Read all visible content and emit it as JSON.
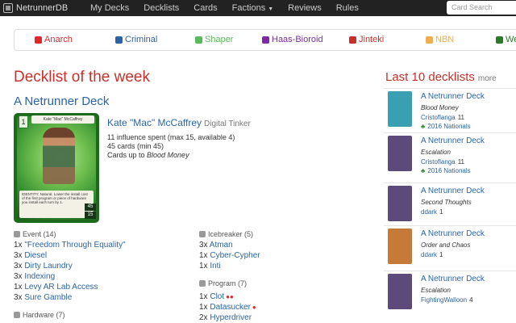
{
  "nav": {
    "brand": "NetrunnerDB",
    "items": [
      {
        "label": "My Decks"
      },
      {
        "label": "Decklists"
      },
      {
        "label": "Cards"
      },
      {
        "label": "Factions"
      },
      {
        "label": "Reviews"
      },
      {
        "label": "Rules"
      }
    ],
    "search_placeholder": "Card Search"
  },
  "factions": [
    {
      "label": "Anarch",
      "color": "#e3262a",
      "icon": "anarch-icon"
    },
    {
      "label": "Criminal",
      "color": "#2a64a6",
      "icon": "criminal-icon"
    },
    {
      "label": "Shaper",
      "color": "#5cb85c",
      "icon": "shaper-icon"
    },
    {
      "label": "Haas-Bioroid",
      "color": "#7e2aa6",
      "icon": "haas-bioroid-icon"
    },
    {
      "label": "Jinteki",
      "color": "#c9302c",
      "icon": "jinteki-icon"
    },
    {
      "label": "NBN",
      "color": "#f0ad4e",
      "icon": "nbn-icon"
    },
    {
      "label": "We",
      "color": "#2a7a2a",
      "icon": "weyland-icon"
    }
  ],
  "main": {
    "section_title": "Decklist of the week",
    "deck_title": "A Netrunner Deck",
    "card_image": {
      "cost": "1",
      "name": "Kate \"Mac\" McCaffrey",
      "stat1": "45",
      "stat2": "15",
      "text": "IDENTITY: Natural. Lower the install cost of the first program or piece of hardware you install each turn by 1."
    },
    "identity": "Kate \"Mac\" McCaffrey",
    "identity_subtype": "Digital Tinker",
    "influence": "11 influence spent (max 15, available 4)",
    "cards": "45 cards (min 45)",
    "cards_up_to_prefix": "Cards up to ",
    "cards_up_to_pack": "Blood Money",
    "left_groups": {
      "event": {
        "label": "Event (14)",
        "items": [
          {
            "qty": "1x",
            "name": "\"Freedom Through Equality\""
          },
          {
            "qty": "3x",
            "name": "Diesel"
          },
          {
            "qty": "3x",
            "name": "Dirty Laundry"
          },
          {
            "qty": "3x",
            "name": "Indexing"
          },
          {
            "qty": "1x",
            "name": "Levy AR Lab Access"
          },
          {
            "qty": "3x",
            "name": "Sure Gamble"
          }
        ]
      },
      "hardware": {
        "label": "Hardware (7)"
      }
    },
    "right_groups": {
      "icebreaker": {
        "label": "Icebreaker (5)",
        "items": [
          {
            "qty": "3x",
            "name": "Atman"
          },
          {
            "qty": "1x",
            "name": "Cyber-Cypher"
          },
          {
            "qty": "1x",
            "name": "Inti"
          }
        ]
      },
      "program": {
        "label": "Program (7)",
        "items": [
          {
            "qty": "1x",
            "name": "Clot",
            "dots": "●●"
          },
          {
            "qty": "1x",
            "name": "Datasucker",
            "dots": "●"
          },
          {
            "qty": "2x",
            "name": "Hyperdriver",
            "dots": ""
          }
        ]
      }
    }
  },
  "recent": {
    "title": "Last 10 decklists",
    "more": "more",
    "entries": [
      {
        "title": "A Netrunner Deck",
        "pack": "Blood Money",
        "user": "Cristoflanga",
        "rep": "11",
        "award": "2016 Nationals",
        "thumb_color": "#3a9fb0"
      },
      {
        "title": "A Netrunner Deck",
        "pack": "Escalation",
        "user": "Cristoflanga",
        "rep": "11",
        "award": "2016 Nationals",
        "thumb_color": "#5b4a7a"
      },
      {
        "title": "A Netrunner Deck",
        "pack": "Second Thoughts",
        "user": "ddark",
        "rep": "1",
        "award": "",
        "thumb_color": "#5b4a7a"
      },
      {
        "title": "A Netrunner Deck",
        "pack": "Order and Chaos",
        "user": "ddark",
        "rep": "1",
        "award": "",
        "thumb_color": "#c57a3a"
      },
      {
        "title": "A Netrunner Deck",
        "pack": "Escalation",
        "user": "FightingWalloon",
        "rep": "4",
        "award": "",
        "thumb_color": "#5b4a7a"
      }
    ]
  }
}
